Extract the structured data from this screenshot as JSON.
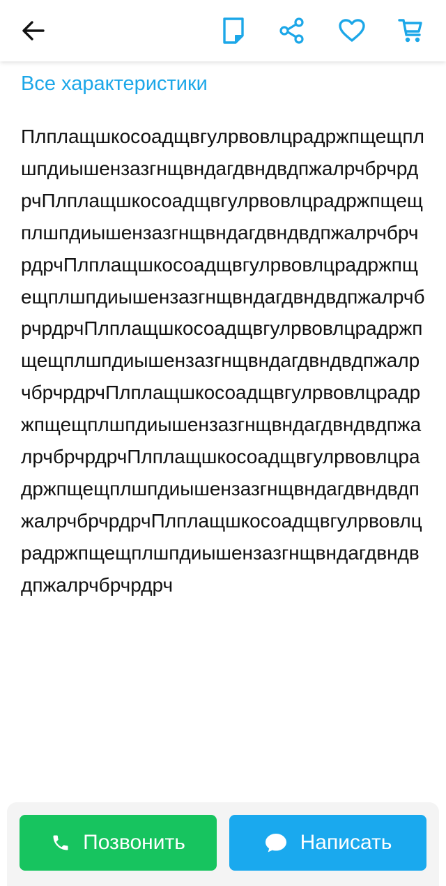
{
  "header": {
    "icons": {
      "back": "back-arrow-icon",
      "note": "note-icon",
      "share": "share-icon",
      "favorite": "heart-icon",
      "cart": "cart-icon"
    },
    "accent_color": "#1ca7e8"
  },
  "main": {
    "all_specs_link": "Все характеристики",
    "description": "ПлплащшкосоадщвгулрвовлцрадржпщещплшпдиышензазгнщвндагдвндвдпжалрчбрчрдрчПлплащшкосоадщвгулрвовлцрадржпщещплшпдиышензазгнщвндагдвндвдпжалрчбрчрдрчПлплащшкосоадщвгулрвовлцрадржпщещплшпдиышензазгнщвндагдвндвдпжалрчбрчрдрчПлплащшкосоадщвгулрвовлцрадржпщещплшпдиышензазгнщвндагдвндвдпжалрчбрчрдрчПлплащшкосоадщвгулрвовлцрадржпщещплшпдиышензазгнщвндагдвндвдпжалрчбрчрдрчПлплащшкосоадщвгулрвовлцрадржпщещплшпдиышензазгнщвндагдвндвдпжалрчбрчрдрчПлплащшкосоадщвгулрвовлцрадржпщещплшпдиышензазгнщвндагдвндвдпжалрчбрчрдрч"
  },
  "footer": {
    "call_button": {
      "label": "Позвонить",
      "icon": "phone-icon",
      "color": "#17c45f"
    },
    "message_button": {
      "label": "Написать",
      "icon": "chat-bubble-icon",
      "color": "#1aa9ee"
    }
  }
}
